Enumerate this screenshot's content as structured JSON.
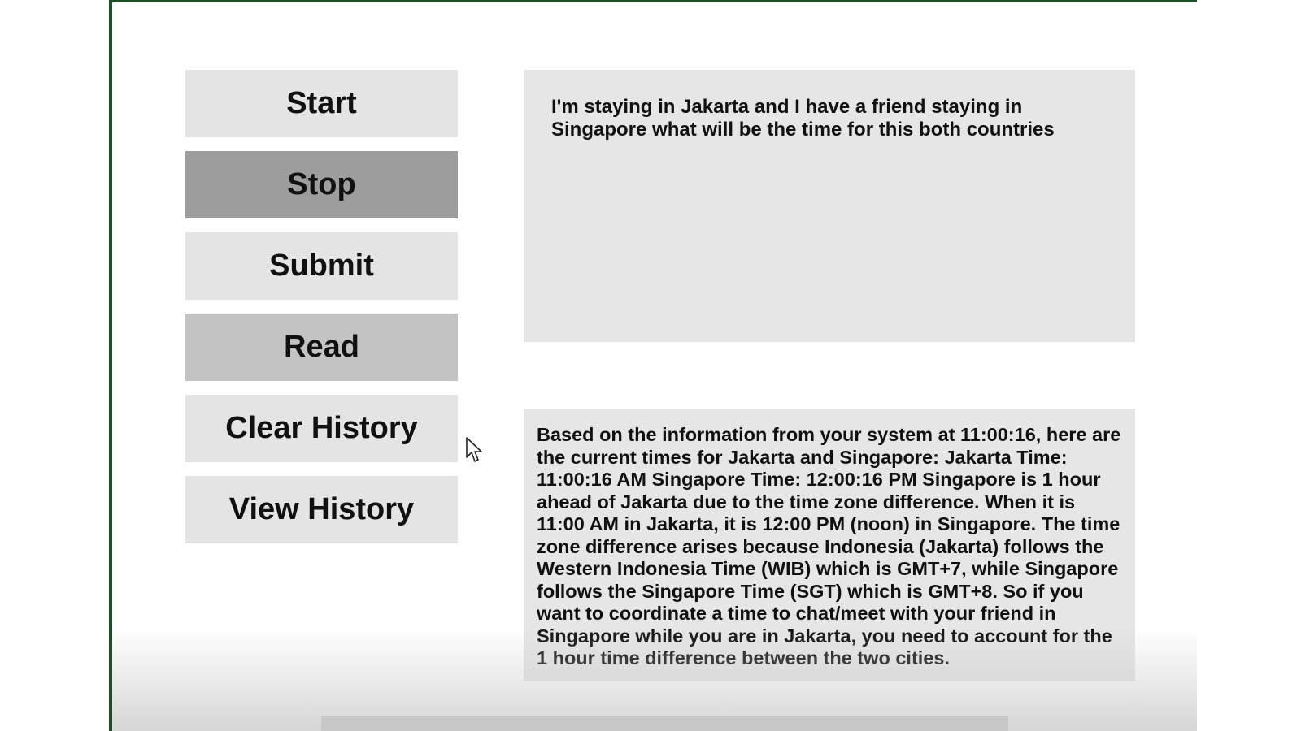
{
  "buttons": {
    "start": "Start",
    "stop": "Stop",
    "submit": "Submit",
    "read": "Read",
    "clear_history": "Clear History",
    "view_history": "View History"
  },
  "query": {
    "text": "I'm staying in Jakarta and I have a friend staying in Singapore what will be the time for this both countries"
  },
  "response": {
    "text": "Based on the information from your system at 11:00:16, here are the current times for Jakarta and Singapore: Jakarta Time: 11:00:16 AM Singapore Time: 12:00:16 PM Singapore is 1 hour ahead of Jakarta due to the time zone difference. When it is 11:00 AM in Jakarta, it is 12:00 PM (noon) in Singapore. The time zone difference arises because Indonesia (Jakarta) follows the Western Indonesia Time (WIB) which is GMT+7, while Singapore follows the Singapore Time (SGT) which is GMT+8. So if you want to coordinate a time to chat/meet with your friend in Singapore while you are in Jakarta, you need to account for the 1 hour time difference between the two cities."
  },
  "colors": {
    "window_border": "#1f4d2a",
    "button_default": "#e4e4e4",
    "button_stop": "#9d9d9d",
    "button_read": "#c3c3c3",
    "text_panel": "#e6e6e6"
  },
  "icons": {
    "cursor": "mouse-pointer-icon"
  }
}
